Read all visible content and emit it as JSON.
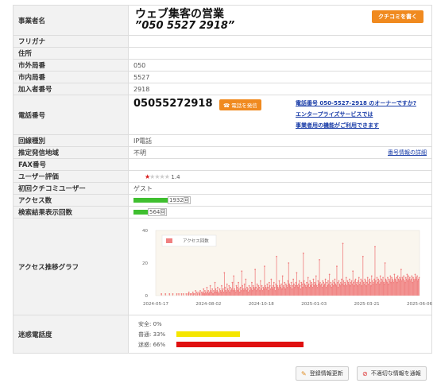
{
  "business": {
    "label": "事業者名",
    "title": "ウェブ集客の営業",
    "phone_display": "”050 5527 2918”",
    "review_button": "クチコミを書く"
  },
  "rows": {
    "furigana": {
      "label": "フリガナ",
      "value": ""
    },
    "address": {
      "label": "住所",
      "value": ""
    },
    "area_code": {
      "label": "市外局番",
      "value": "050"
    },
    "local_code": {
      "label": "市内局番",
      "value": "5527"
    },
    "subscriber": {
      "label": "加入者番号",
      "value": "2918"
    },
    "line_type": {
      "label": "回線種別",
      "value": "IP電話"
    },
    "region": {
      "label": "推定発信地域",
      "value": "不明",
      "link": "番号情報の詳細"
    },
    "fax": {
      "label": "FAX番号",
      "value": ""
    },
    "rating": {
      "label": "ユーザー評価",
      "value": "1.4",
      "stars_filled": 1,
      "stars_total": 5
    },
    "first_user": {
      "label": "初回クチコミユーザー",
      "value": "ゲスト"
    },
    "access": {
      "label": "アクセス数",
      "value": "1932回",
      "bar_fraction": 0.12
    },
    "search": {
      "label": "検索結果表示回数",
      "value": "564回",
      "bar_fraction": 0.05
    }
  },
  "phone": {
    "label": "電話番号",
    "number": "05055272918",
    "call_button": "電話を発信",
    "owner_line1": "電話番号 050-5527-2918 のオーナーですか?",
    "owner_line2": "エンタープライズサービスでは",
    "owner_line3": "事業者用の機能がご利用できます"
  },
  "graph": {
    "label": "アクセス推移グラフ"
  },
  "chart_data": {
    "type": "bar",
    "series": [
      {
        "name": "アクセス回数",
        "color": "#f08080"
      }
    ],
    "ylim": [
      0,
      40
    ],
    "yticks": [
      0,
      20,
      40
    ],
    "xticks": [
      "2024-05-17",
      "2024-08-02",
      "2024-10-18",
      "2025-01-03",
      "2025-03-21",
      "2025-06-06"
    ],
    "legend": "top-left",
    "grid": false,
    "values": [
      0,
      0,
      0,
      0,
      0,
      0,
      0,
      0,
      1,
      0,
      0,
      0,
      0,
      0,
      1,
      0,
      0,
      0,
      0,
      0,
      1,
      0,
      0,
      0,
      0,
      1,
      0,
      0,
      0,
      0,
      0,
      1,
      0,
      0,
      1,
      0,
      0,
      0,
      1,
      0,
      0,
      1,
      0,
      0,
      0,
      1,
      0,
      0,
      1,
      2,
      0,
      1,
      0,
      1,
      0,
      2,
      1,
      0,
      1,
      3,
      0,
      2,
      1,
      0,
      2,
      1,
      3,
      0,
      2,
      1,
      2,
      4,
      1,
      3,
      2,
      1,
      5,
      2,
      3,
      1,
      2,
      6,
      3,
      2,
      4,
      1,
      3,
      2,
      8,
      4,
      2,
      3,
      5,
      2,
      1,
      4,
      3,
      2,
      6,
      3,
      4,
      2,
      14,
      5,
      3,
      2,
      7,
      4,
      3,
      6,
      2,
      5,
      3,
      4,
      8,
      3,
      12,
      4,
      3,
      2,
      6,
      5,
      3,
      8,
      4,
      2,
      5,
      3,
      15,
      6,
      4,
      3,
      7,
      4,
      10,
      3,
      5,
      4,
      2,
      6,
      3,
      5,
      4,
      8,
      3,
      6,
      5,
      4,
      16,
      5,
      3,
      7,
      4,
      6,
      5,
      3,
      9,
      4,
      6,
      3,
      5,
      4,
      18,
      6,
      5,
      4,
      7,
      5,
      3,
      8,
      6,
      4,
      10,
      5,
      4,
      6,
      8,
      5,
      3,
      7,
      24,
      6,
      5,
      4,
      9,
      6,
      5,
      7,
      4,
      12,
      6,
      5,
      8,
      4,
      7,
      6,
      5,
      9,
      20,
      7,
      6,
      5,
      8,
      4,
      6,
      10,
      7,
      5,
      6,
      8,
      14,
      6,
      5,
      7,
      9,
      6,
      4,
      8,
      7,
      5,
      26,
      9,
      7,
      6,
      5,
      8,
      6,
      11,
      7,
      5,
      9,
      6,
      8,
      7,
      5,
      10,
      6,
      8,
      7,
      12,
      6,
      5,
      9,
      7,
      22,
      8,
      6,
      7,
      5,
      9,
      8,
      6,
      7,
      10,
      5,
      8,
      6,
      9,
      7,
      13,
      6,
      8,
      5,
      7,
      9,
      6,
      8,
      10,
      7,
      6,
      18,
      8,
      5,
      9,
      7,
      6,
      8,
      10,
      7,
      32,
      9,
      6,
      8,
      7,
      11,
      6,
      9,
      8,
      7,
      10,
      6,
      8,
      9,
      7,
      15,
      8,
      6,
      9,
      10,
      7,
      8,
      6,
      9,
      11,
      7,
      8,
      10,
      6,
      9,
      24,
      8,
      7,
      10,
      9,
      6,
      8,
      11,
      7,
      9,
      10,
      8,
      6,
      12,
      9,
      7,
      8,
      10,
      30,
      9,
      7,
      11,
      8,
      10,
      9,
      7,
      12,
      8,
      10,
      9,
      11,
      8,
      7,
      20,
      10,
      9,
      8,
      11,
      7,
      10,
      9,
      12,
      8,
      11,
      10,
      9,
      8,
      13,
      10,
      9,
      11,
      8,
      12,
      10,
      9,
      11,
      10,
      16,
      9,
      11,
      10,
      12,
      9,
      8,
      11,
      10,
      13,
      9,
      12,
      10,
      11,
      9,
      10,
      12,
      8,
      11,
      10,
      9,
      13,
      10,
      11,
      12,
      9,
      10,
      11
    ]
  },
  "spam": {
    "label": "迷惑電話度",
    "safe": "安全: 0%",
    "normal": "普通: 33%",
    "spam": "迷惑: 66%",
    "safe_fraction": 0.0,
    "normal_fraction": 0.33,
    "spam_fraction": 0.66,
    "color_normal": "#f5e600",
    "color_spam": "#e01010"
  },
  "actions": {
    "update": "登録情報更新",
    "report": "不適切な情報を通報"
  }
}
